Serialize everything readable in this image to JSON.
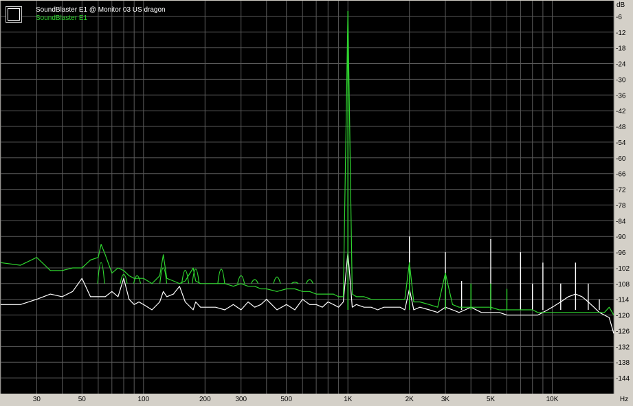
{
  "legend": {
    "entries": [
      {
        "label": "SoundBlaster E1 @ Monitor 03 US dragon",
        "color": "#ffffff"
      },
      {
        "label": "SoundBlaster E1",
        "color": "#2fd62f"
      }
    ]
  },
  "colors": {
    "background": "#000000",
    "panel": "#d4d0c8",
    "grid": "#5a5a5a",
    "white_series": "#ffffff",
    "green_series": "#2fd62f"
  },
  "chart_data": {
    "type": "line",
    "title": "",
    "x_scale": "log",
    "xlim": [
      20,
      20000
    ],
    "ylim": [
      -150,
      0
    ],
    "xlabel": "Hz",
    "ylabel": "dB",
    "x_tick_labels": [
      {
        "value": 30,
        "label": "30"
      },
      {
        "value": 50,
        "label": "50"
      },
      {
        "value": 100,
        "label": "100"
      },
      {
        "value": 200,
        "label": "200"
      },
      {
        "value": 300,
        "label": "300"
      },
      {
        "value": 500,
        "label": "500"
      },
      {
        "value": 1000,
        "label": "1K"
      },
      {
        "value": 2000,
        "label": "2K"
      },
      {
        "value": 3000,
        "label": "3K"
      },
      {
        "value": 5000,
        "label": "5K"
      },
      {
        "value": 10000,
        "label": "10K"
      }
    ],
    "y_ticks": [
      -6,
      -12,
      -18,
      -24,
      -30,
      -36,
      -42,
      -48,
      -54,
      -60,
      -66,
      -72,
      -78,
      -84,
      -90,
      -96,
      -102,
      -108,
      -114,
      -120,
      -126,
      -132,
      -138,
      -144
    ],
    "grid": true,
    "series": [
      {
        "name": "SoundBlaster E1 @ Monitor 03 US dragon",
        "color": "#ffffff",
        "x": [
          20,
          25,
          30,
          35,
          40,
          45,
          50,
          55,
          60,
          65,
          70,
          75,
          80,
          85,
          90,
          95,
          100,
          110,
          120,
          125,
          130,
          140,
          150,
          160,
          175,
          180,
          190,
          200,
          225,
          250,
          275,
          300,
          325,
          350,
          375,
          400,
          450,
          500,
          550,
          600,
          650,
          700,
          750,
          800,
          850,
          900,
          950,
          1000,
          1050,
          1100,
          1200,
          1300,
          1400,
          1500,
          1600,
          1700,
          1800,
          1900,
          2000,
          2100,
          2250,
          2500,
          2750,
          3000,
          3250,
          3500,
          3750,
          4000,
          4500,
          5000,
          5500,
          6000,
          6500,
          7000,
          7500,
          8000,
          8500,
          9000,
          9500,
          10000,
          10500,
          11000,
          12000,
          13000,
          14000,
          15000,
          16000,
          17000,
          18000,
          19000,
          20000
        ],
        "y": [
          -116,
          -116,
          -114,
          -112,
          -113,
          -111,
          -106,
          -113,
          -113,
          -113,
          -111,
          -113,
          -106,
          -114,
          -116,
          -115,
          -116,
          -118,
          -115,
          -111,
          -113,
          -112,
          -109,
          -115,
          -118,
          -115,
          -117,
          -117,
          -117,
          -118,
          -116,
          -118,
          -115,
          -117,
          -116,
          -114,
          -118,
          -116,
          -118,
          -114,
          -116,
          -116,
          -117,
          -115,
          -116,
          -117,
          -115,
          -96,
          -117,
          -116,
          -117,
          -117,
          -118,
          -117,
          -117,
          -117,
          -117,
          -118,
          -110,
          -118,
          -117,
          -118,
          -119,
          -117,
          -118,
          -119,
          -118,
          -117,
          -119,
          -119,
          -119,
          -120,
          -120,
          -120,
          -120,
          -120,
          -120,
          -119,
          -118,
          -117,
          -116,
          -115,
          -113,
          -112,
          -113,
          -115,
          -117,
          -119,
          -120,
          -121,
          -127
        ],
        "spikes": [
          {
            "x": 1000,
            "y": -96
          },
          {
            "x": 2000,
            "y": -90
          },
          {
            "x": 3000,
            "y": -96
          },
          {
            "x": 3600,
            "y": -107
          },
          {
            "x": 5000,
            "y": -91
          },
          {
            "x": 7000,
            "y": -96
          },
          {
            "x": 8000,
            "y": -108
          },
          {
            "x": 9000,
            "y": -100
          },
          {
            "x": 11000,
            "y": -108
          },
          {
            "x": 13000,
            "y": -100
          },
          {
            "x": 15000,
            "y": -108
          },
          {
            "x": 17000,
            "y": -114
          }
        ]
      },
      {
        "name": "SoundBlaster E1",
        "color": "#2fd62f",
        "x": [
          20,
          25,
          30,
          35,
          40,
          45,
          50,
          55,
          60,
          62,
          65,
          70,
          75,
          80,
          85,
          90,
          100,
          110,
          120,
          125,
          130,
          140,
          150,
          160,
          175,
          180,
          190,
          200,
          225,
          250,
          275,
          300,
          325,
          350,
          375,
          400,
          450,
          500,
          550,
          600,
          650,
          700,
          750,
          800,
          850,
          900,
          950,
          1000,
          1050,
          1100,
          1200,
          1300,
          1400,
          1500,
          1600,
          1700,
          1800,
          1900,
          2000,
          2100,
          2250,
          2500,
          2750,
          3000,
          3250,
          3500,
          3750,
          4000,
          4500,
          5000,
          5500,
          6000,
          6500,
          7000,
          7500,
          8000,
          8500,
          9000,
          9500,
          10000,
          10500,
          11000,
          12000,
          13000,
          14000,
          15000,
          16000,
          17000,
          18000,
          19000,
          20000
        ],
        "y": [
          -100,
          -101,
          -98,
          -103,
          -103,
          -102,
          -102,
          -99,
          -98,
          -93,
          -97,
          -104,
          -102,
          -103,
          -105,
          -106,
          -106,
          -108,
          -105,
          -97,
          -106,
          -107,
          -108,
          -107,
          -102,
          -107,
          -108,
          -108,
          -108,
          -108,
          -109,
          -108,
          -109,
          -109,
          -110,
          -110,
          -111,
          -110,
          -110,
          -111,
          -111,
          -112,
          -112,
          -112,
          -112,
          -113,
          -113,
          -4,
          -112,
          -113,
          -113,
          -114,
          -114,
          -114,
          -114,
          -114,
          -114,
          -114,
          -100,
          -115,
          -115,
          -116,
          -117,
          -104,
          -116,
          -117,
          -117,
          -117,
          -117,
          -117,
          -118,
          -118,
          -118,
          -118,
          -118,
          -118,
          -119,
          -119,
          -119,
          -119,
          -119,
          -119,
          -119,
          -119,
          -119,
          -119,
          -119,
          -119,
          -119,
          -117,
          -120
        ],
        "spikes": [
          {
            "x": 1000,
            "y": -4
          },
          {
            "x": 2000,
            "y": -100
          },
          {
            "x": 3000,
            "y": -104
          },
          {
            "x": 4000,
            "y": -108
          },
          {
            "x": 5000,
            "y": -108
          },
          {
            "x": 6000,
            "y": -110
          }
        ],
        "harmonic_bumps": [
          {
            "x": 62,
            "y": -93
          },
          {
            "x": 80,
            "y": -102
          },
          {
            "x": 93,
            "y": -103
          },
          {
            "x": 125,
            "y": -97
          },
          {
            "x": 160,
            "y": -99
          },
          {
            "x": 180,
            "y": -98
          },
          {
            "x": 240,
            "y": -98
          },
          {
            "x": 300,
            "y": -103
          },
          {
            "x": 350,
            "y": -106
          },
          {
            "x": 450,
            "y": -104
          },
          {
            "x": 550,
            "y": -108
          },
          {
            "x": 650,
            "y": -106
          }
        ]
      }
    ]
  }
}
